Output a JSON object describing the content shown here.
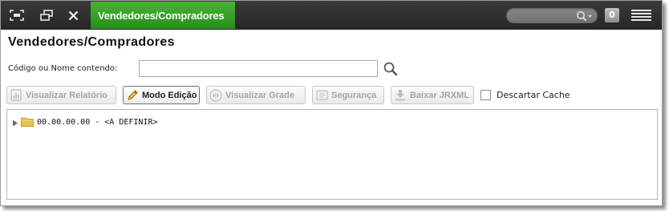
{
  "titlebar": {
    "app_tab": "Vendedores/Compradores",
    "notification_count": "0",
    "accent_color": "#3aa02a"
  },
  "page": {
    "title": "Vendedores/Compradores",
    "search_label": "Código ou Nome contendo:",
    "search_value": "",
    "search_placeholder": ""
  },
  "toolbar": {
    "buttons": [
      {
        "label": "Visualizar Relatório",
        "icon": "report-icon",
        "enabled": false
      },
      {
        "label": "Modo Edição",
        "icon": "pencil-icon",
        "enabled": true
      },
      {
        "label": "Visualizar Grade",
        "icon": "grid-icon",
        "enabled": false
      },
      {
        "label": "Segurança",
        "icon": "security-icon",
        "enabled": false
      },
      {
        "label": "Baixar JRXML",
        "icon": "download-icon",
        "enabled": false
      }
    ],
    "discard_cache_label": "Descartar Cache",
    "discard_cache_checked": false
  },
  "tree": {
    "nodes": [
      {
        "label": "00.00.00.00 - <A DEFINIR>",
        "icon": "folder-icon",
        "expanded": false
      }
    ]
  }
}
